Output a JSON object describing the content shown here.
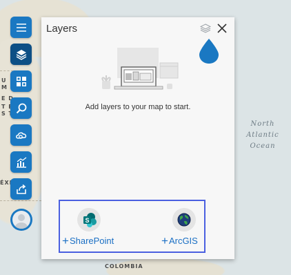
{
  "map": {
    "ocean_label": [
      "North",
      "Atlantic",
      "Ocean"
    ],
    "country_label": "COLOMBIA",
    "edge_labels": [
      "U",
      "M",
      "E D",
      "T E S",
      "S T",
      "ÉXI"
    ]
  },
  "toolbar": {
    "items": [
      {
        "name": "menu",
        "icon": "hamburger-icon",
        "active": false
      },
      {
        "name": "layers",
        "icon": "layers-icon",
        "active": true
      },
      {
        "name": "basemap",
        "icon": "basemap-gallery-icon",
        "active": false
      },
      {
        "name": "search",
        "icon": "search-icon",
        "active": false
      },
      {
        "name": "analysis",
        "icon": "cloud-analysis-icon",
        "active": false
      },
      {
        "name": "chart",
        "icon": "chart-icon",
        "active": false
      },
      {
        "name": "share",
        "icon": "share-icon",
        "active": false
      }
    ],
    "avatar_icon": "user-avatar-icon"
  },
  "layers_panel": {
    "title": "Layers",
    "empty_message": "Add layers to your map to start.",
    "sources": [
      {
        "label": "SharePoint",
        "icon": "sharepoint-icon",
        "prefix": "+"
      },
      {
        "label": "ArcGIS",
        "icon": "arcgis-globe-icon",
        "prefix": "+"
      }
    ]
  },
  "colors": {
    "toolbar_blue": "#1a78c2",
    "toolbar_active": "#0d4f85",
    "link_blue": "#1a6fc4",
    "highlight_border": "#4a5fe0"
  }
}
